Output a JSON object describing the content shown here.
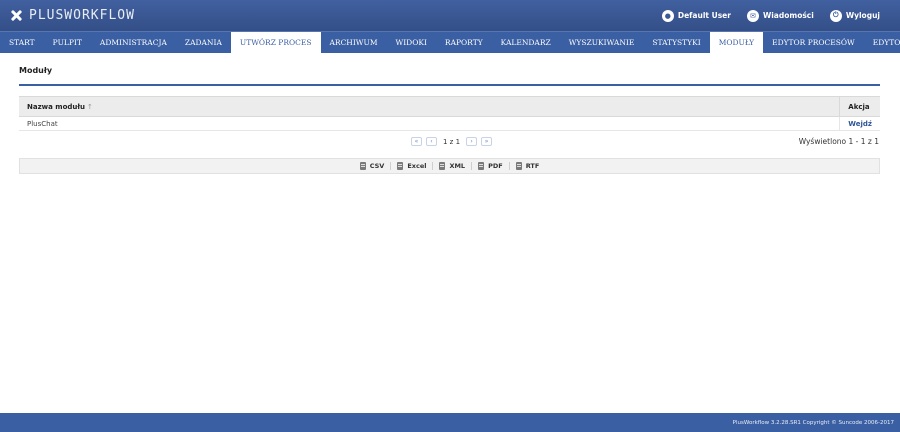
{
  "app": {
    "logo_text": "PLUSWORKFLOW"
  },
  "header": {
    "user": "Default User",
    "messages": "Wiadomości",
    "logout": "Wyloguj"
  },
  "nav": {
    "items": [
      {
        "label": "START"
      },
      {
        "label": "PULPIT"
      },
      {
        "label": "ADMINISTRACJA"
      },
      {
        "label": "ZADANIA"
      },
      {
        "label": "UTWÓRZ PROCES"
      },
      {
        "label": "ARCHIWUM"
      },
      {
        "label": "WIDOKI"
      },
      {
        "label": "RAPORTY"
      },
      {
        "label": "KALENDARZ"
      },
      {
        "label": "WYSZUKIWANIE"
      },
      {
        "label": "STATYSTYKI"
      },
      {
        "label": "MODUŁY"
      },
      {
        "label": "EDYTOR PROCESÓW"
      },
      {
        "label": "EDYTOR DANYCH"
      }
    ]
  },
  "page": {
    "title": "Moduły"
  },
  "table": {
    "col_name": "Nazwa modułu",
    "col_action": "Akcja",
    "rows": [
      {
        "name": "PlusChat",
        "action": "Wejdź"
      }
    ]
  },
  "pager": {
    "first": "«",
    "prev": "‹",
    "info": "1 z 1",
    "next": "›",
    "last": "»",
    "shown": "Wyświetlono 1 - 1 z 1"
  },
  "export": {
    "csv": "CSV",
    "excel": "Excel",
    "xml": "XML",
    "pdf": "PDF",
    "rtf": "RTF"
  },
  "footer": {
    "text": "PlusWorkflow 3.2.28.SR1 Copyright © Suncode 2006-2017"
  }
}
